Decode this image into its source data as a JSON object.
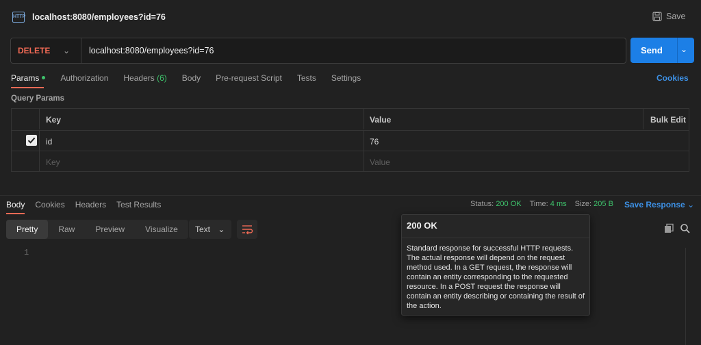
{
  "window": {
    "tab_title": "localhost:8080/employees?id=76",
    "save_label": "Save",
    "http_badge": "HTTP"
  },
  "request": {
    "method": "DELETE",
    "url": "localhost:8080/employees?id=76",
    "send_label": "Send"
  },
  "tabs": {
    "params": "Params",
    "authorization": "Authorization",
    "headers": "Headers",
    "headers_count": "(6)",
    "body": "Body",
    "prerequest": "Pre-request Script",
    "tests": "Tests",
    "settings": "Settings",
    "cookies": "Cookies"
  },
  "query_params": {
    "label": "Query Params",
    "headers": {
      "key": "Key",
      "value": "Value",
      "bulk_edit": "Bulk Edit"
    },
    "rows": [
      {
        "checked": true,
        "key": "id",
        "value": "76"
      }
    ],
    "placeholder": {
      "key": "Key",
      "value": "Value"
    }
  },
  "response": {
    "tabs": [
      "Body",
      "Cookies",
      "Headers",
      "Test Results"
    ],
    "status_label": "Status:",
    "status_value": "200 OK",
    "time_label": "Time:",
    "time_value": "4 ms",
    "size_label": "Size:",
    "size_value": "205 B",
    "save_response": "Save Response",
    "views": [
      "Pretty",
      "Raw",
      "Preview",
      "Visualize"
    ],
    "format": "Text",
    "line_numbers": [
      "1"
    ]
  },
  "tooltip": {
    "title": "200 OK",
    "body": "Standard response for successful HTTP requests. The actual response will depend on the request method used. In a GET request, the response will contain an entity corresponding to the requested resource. In a POST request the response will contain an entity describing or containing the result of the action."
  },
  "colors": {
    "accent": "#1c7fe6",
    "method": "#f06a55",
    "success": "#3ec26b",
    "link": "#3d91e6"
  }
}
